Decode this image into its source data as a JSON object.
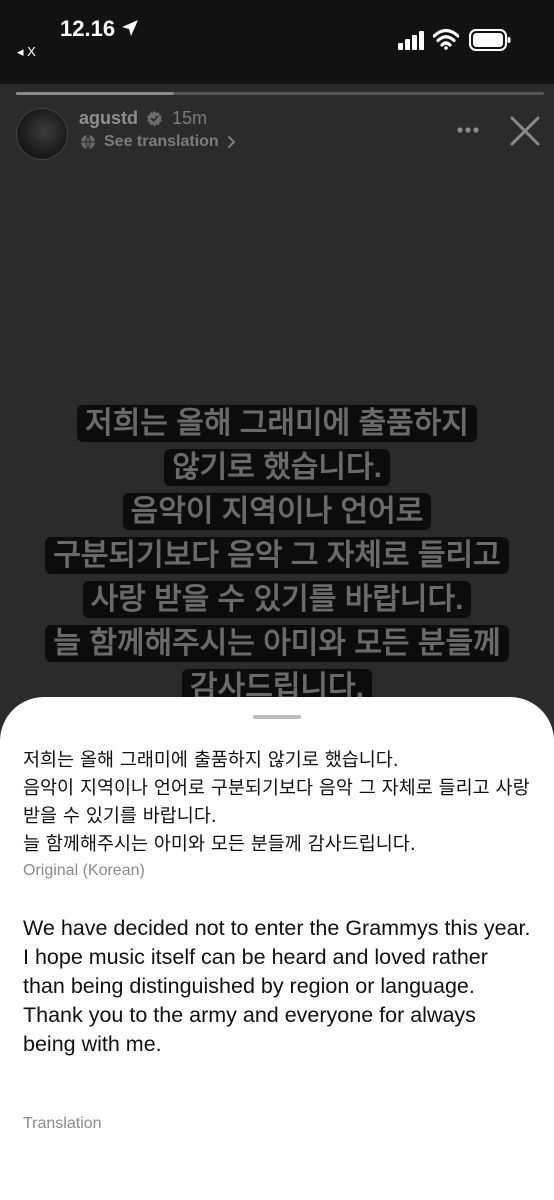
{
  "status_bar": {
    "time": "12.16",
    "back_app": "◂ X",
    "icons": [
      "location-arrow-icon",
      "signal-icon",
      "wifi-icon",
      "battery-icon"
    ]
  },
  "story": {
    "progress": 0.3,
    "username": "agustd",
    "verified_icon": "verified-badge-icon",
    "time_ago": "15m",
    "see_translation": "See translation",
    "story_lines": [
      "저희는 올해 그래미에 출품하지",
      "않기로 했습니다.",
      "음악이 지역이나 언어로",
      "구분되기보다 음악 그 자체로 들리고",
      "사랑 받을 수 있기를 바랍니다.",
      "늘 함께해주시는 아미와 모든 분들께",
      "감사드립니다."
    ]
  },
  "sheet": {
    "original_text": "저희는 올해 그래미에 출품하지 않기로 했습니다.\n음악이 지역이나 언어로 구분되기보다 음악 그 자체로 들리고 사랑 받을 수 있기를 바랍니다.\n늘 함께해주시는 아미와 모든 분들께 감사드립니다.",
    "original_label": "Original (Korean)",
    "translated_text": "We have decided not to enter the Grammys this year.\nI hope music itself can be heard and loved rather than being distinguished by region or language.\nThank you to the army and everyone for always being with me.",
    "translation_label": "Translation"
  },
  "colors": {
    "status_bar_bg": "#121212",
    "story_bg": "#2b2b2b",
    "story_text": "#6a6a6a",
    "sheet_bg": "#ffffff",
    "label_gray": "#8a8a8a"
  }
}
